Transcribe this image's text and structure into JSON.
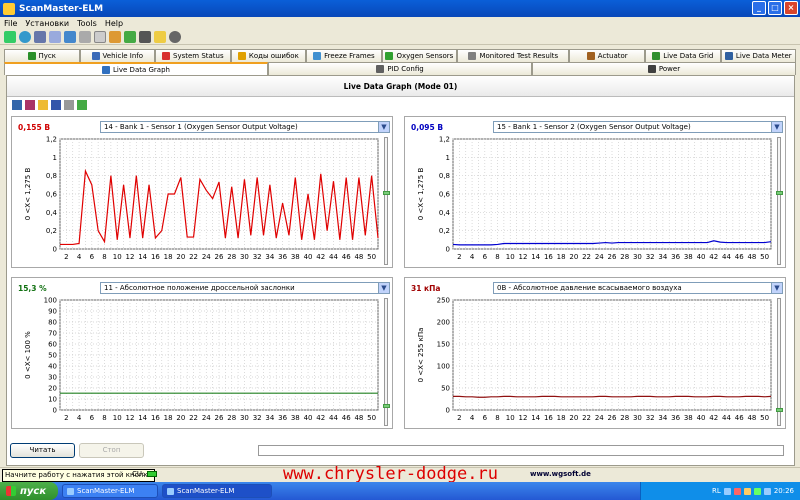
{
  "window": {
    "title": "ScanMaster-ELM"
  },
  "menu": [
    "File",
    "Установки",
    "Tools",
    "Help"
  ],
  "tabs_row1": [
    {
      "label": "Пуск",
      "icon": "start-icon",
      "color": "#2a8f2a"
    },
    {
      "label": "Vehicle Info",
      "icon": "info-icon",
      "color": "#3a6ab8"
    },
    {
      "label": "System Status",
      "icon": "status-icon",
      "color": "#d83030"
    },
    {
      "label": "Коды ошибок",
      "icon": "warning-icon",
      "color": "#e0a000"
    },
    {
      "label": "Freeze Frames",
      "icon": "freeze-icon",
      "color": "#4090d0"
    },
    {
      "label": "Oxygen Sensors",
      "icon": "oxygen-icon",
      "color": "#30a030"
    },
    {
      "label": "Monitored Test Results",
      "icon": "test-icon",
      "color": "#808080"
    },
    {
      "label": "Actuator",
      "icon": "actuator-icon",
      "color": "#a06020"
    },
    {
      "label": "Live Data Grid",
      "icon": "grid-icon",
      "color": "#309030"
    },
    {
      "label": "Live Data Meter",
      "icon": "meter-icon",
      "color": "#3060a0"
    }
  ],
  "tabs_row2": [
    {
      "label": "Live Data Graph",
      "icon": "graph-icon",
      "color": "#3070c0",
      "active": true
    },
    {
      "label": "PID Config",
      "icon": "config-icon",
      "color": "#606060",
      "active": false
    },
    {
      "label": "Power",
      "icon": "power-icon",
      "color": "#404040",
      "active": false
    }
  ],
  "panel": {
    "title": "Live Data Graph (Mode 01)"
  },
  "graph_tools": [
    "add-graph-icon",
    "remove-graph-icon",
    "open-icon",
    "save-icon",
    "print-icon",
    "export-icon"
  ],
  "chart_data": [
    {
      "type": "line",
      "value_text": "0,155 В",
      "value_color": "#d00000",
      "pid": "14 - Bank 1 - Sensor 1 (Oxygen Sensor Output Voltage)",
      "ylabel": "0 <X< 1,275 В",
      "ylim": [
        0,
        1.2
      ],
      "yticks": [
        "0",
        "0,2",
        "0,4",
        "0,6",
        "0,8",
        "1",
        "1,2"
      ],
      "xlim": [
        1,
        51
      ],
      "xticks": [
        "2",
        "4",
        "6",
        "8",
        "10",
        "12",
        "14",
        "16",
        "18",
        "20",
        "22",
        "24",
        "26",
        "28",
        "30",
        "32",
        "34",
        "36",
        "38",
        "40",
        "42",
        "44",
        "46",
        "48",
        "50"
      ],
      "color": "#e00000",
      "slider": 0.43,
      "series": [
        {
          "values": [
            0.05,
            0.05,
            0.05,
            0.06,
            0.85,
            0.7,
            0.2,
            0.08,
            0.8,
            0.1,
            0.7,
            0.12,
            0.8,
            0.12,
            0.7,
            0.12,
            0.2,
            0.6,
            0.6,
            0.78,
            0.13,
            0.13,
            0.76,
            0.64,
            0.55,
            0.73,
            0.12,
            0.68,
            0.12,
            0.76,
            0.15,
            0.78,
            0.15,
            0.7,
            0.12,
            0.5,
            0.15,
            0.78,
            0.1,
            0.6,
            0.1,
            0.82,
            0.2,
            0.74,
            0.1,
            0.78,
            0.1,
            0.78,
            0.15,
            0.8,
            0.12
          ]
        }
      ]
    },
    {
      "type": "line",
      "value_text": "0,095 В",
      "value_color": "#0000c0",
      "pid": "15 - Bank 1 - Sensor 2 (Oxygen Sensor Output Voltage)",
      "ylabel": "0 <X< 1,275 В",
      "ylim": [
        0,
        1.2
      ],
      "yticks": [
        "0",
        "0,2",
        "0,4",
        "0,6",
        "0,8",
        "1",
        "1,2"
      ],
      "xlim": [
        1,
        51
      ],
      "xticks": [
        "2",
        "4",
        "6",
        "8",
        "10",
        "12",
        "14",
        "16",
        "18",
        "20",
        "22",
        "24",
        "26",
        "28",
        "30",
        "32",
        "34",
        "36",
        "38",
        "40",
        "42",
        "44",
        "46",
        "48",
        "50"
      ],
      "color": "#0000d0",
      "slider": 0.43,
      "series": [
        {
          "values": [
            0.05,
            0.045,
            0.045,
            0.045,
            0.045,
            0.045,
            0.045,
            0.05,
            0.06,
            0.06,
            0.06,
            0.06,
            0.06,
            0.06,
            0.06,
            0.06,
            0.06,
            0.06,
            0.06,
            0.06,
            0.06,
            0.06,
            0.06,
            0.065,
            0.07,
            0.065,
            0.07,
            0.07,
            0.07,
            0.07,
            0.07,
            0.07,
            0.07,
            0.07,
            0.07,
            0.07,
            0.07,
            0.07,
            0.07,
            0.07,
            0.07,
            0.09,
            0.075,
            0.07,
            0.07,
            0.07,
            0.07,
            0.07,
            0.07,
            0.07,
            0.08
          ]
        }
      ]
    },
    {
      "type": "line",
      "value_text": "15,3 %",
      "value_color": "#107010",
      "pid": "11 - Абсолютное положение дроссельной заслонки",
      "ylabel": "0 <X< 100 %",
      "ylim": [
        0,
        100
      ],
      "yticks": [
        "0",
        "10",
        "20",
        "30",
        "40",
        "50",
        "60",
        "70",
        "80",
        "90",
        "100"
      ],
      "xlim": [
        1,
        51
      ],
      "xticks": [
        "2",
        "4",
        "6",
        "8",
        "10",
        "12",
        "14",
        "16",
        "18",
        "20",
        "22",
        "24",
        "26",
        "28",
        "30",
        "32",
        "34",
        "36",
        "38",
        "40",
        "42",
        "44",
        "46",
        "48",
        "50"
      ],
      "color": "#208020",
      "slider": 0.85,
      "series": [
        {
          "values": [
            15.3,
            15.3,
            15.3,
            15.3,
            15.3,
            15.3,
            15.3,
            15.3,
            15.3,
            15.3,
            15.3,
            15.3,
            15.3,
            15.3,
            15.3,
            15.3,
            15.3,
            15.3,
            15.3,
            15.3,
            15.3,
            15.3,
            15.3,
            15.3,
            15.3,
            15.3,
            15.3,
            15.3,
            15.3,
            15.3,
            15.3,
            15.3,
            15.3,
            15.3,
            15.3,
            15.3,
            15.3,
            15.3,
            15.3,
            15.3,
            15.3,
            15.3,
            15.3,
            15.3,
            15.3,
            15.3,
            15.3,
            15.3,
            15.3,
            15.3,
            15.3
          ]
        }
      ]
    },
    {
      "type": "line",
      "value_text": "31 кПа",
      "value_color": "#a00000",
      "pid": "0B - Абсолютное давление всасываемого воздуха",
      "ylabel": "0 <X< 255 кПа",
      "ylim": [
        0,
        250
      ],
      "yticks": [
        "0",
        "50",
        "100",
        "150",
        "200",
        "250"
      ],
      "xlim": [
        1,
        51
      ],
      "xticks": [
        "2",
        "4",
        "6",
        "8",
        "10",
        "12",
        "14",
        "16",
        "18",
        "20",
        "22",
        "24",
        "26",
        "28",
        "30",
        "32",
        "34",
        "36",
        "38",
        "40",
        "42",
        "44",
        "46",
        "48",
        "50"
      ],
      "color": "#901010",
      "slider": 0.88,
      "series": [
        {
          "values": [
            31,
            31,
            30,
            30,
            29,
            29,
            30,
            30,
            31,
            31,
            30,
            30,
            30,
            30,
            31,
            31,
            31,
            30,
            30,
            30,
            30,
            30,
            30,
            31,
            31,
            30,
            30,
            30,
            30,
            31,
            31,
            31,
            30,
            30,
            30,
            31,
            31,
            31,
            30,
            30,
            30,
            31,
            31,
            30,
            30,
            30,
            31,
            31,
            31,
            30,
            31
          ]
        }
      ]
    }
  ],
  "buttons": {
    "read": "Читать",
    "stop": "Стоп"
  },
  "status": {
    "tooltip": "Начните работу с нажатия этой кнопки",
    "cu": "CU:",
    "site": "www.wgsoft.de"
  },
  "watermark": "www.chrysler-dodge.ru",
  "taskbar": {
    "start": "пуск",
    "task1": "ScanMaster-ELM",
    "task2": "ScanMaster-ELM",
    "lang": "RL",
    "clock": "20:26"
  },
  "colors": {
    "title_bar": "#0847b8",
    "taskbar": "#2458d3",
    "start": "#2f8f2c"
  }
}
